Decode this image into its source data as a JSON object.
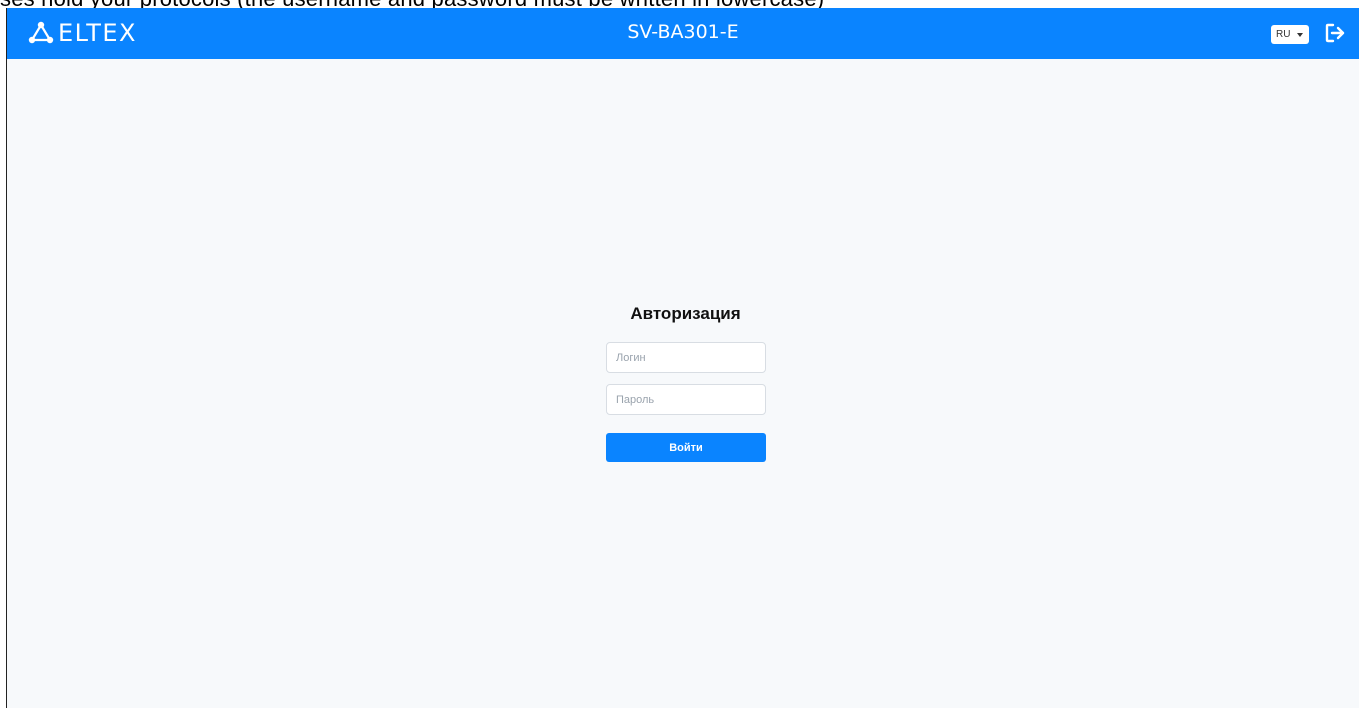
{
  "top_strip": {
    "text": "ses hold your protocols (the username and password must be written in lowercase)"
  },
  "header": {
    "logo_text": "ELTEX",
    "device_title": "SV-BA301-E",
    "language": {
      "selected": "RU",
      "icon": "chevron-down-icon"
    },
    "logout_icon": "logout-icon",
    "background_color": "#0a84ff"
  },
  "login": {
    "title": "Авторизация",
    "login_placeholder": "Логин",
    "login_value": "",
    "password_placeholder": "Пароль",
    "password_value": "",
    "submit_label": "Войти",
    "button_color": "#0a84ff"
  }
}
